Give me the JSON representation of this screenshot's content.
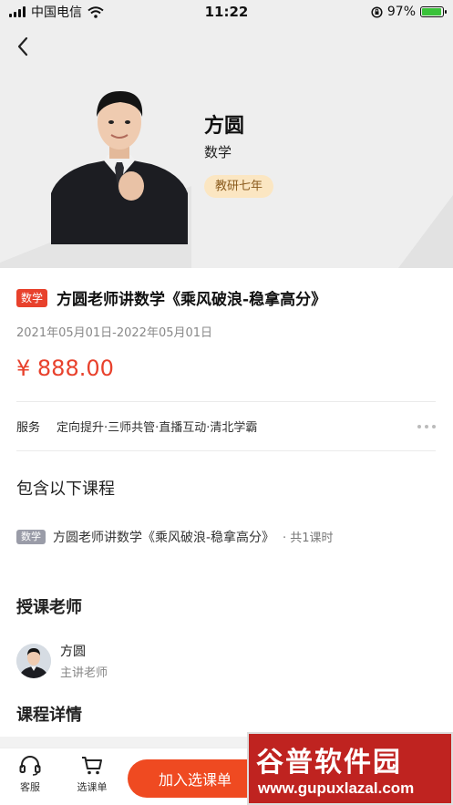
{
  "status_bar": {
    "carrier": "中国电信",
    "time": "11:22",
    "battery": "97%",
    "battery_level": 0.97
  },
  "hero": {
    "name": "方圆",
    "subject": "数学",
    "badge": "教研七年"
  },
  "course": {
    "tag": "数学",
    "title": "方圆老师讲数学《乘风破浪-稳拿高分》",
    "dates": "2021年05月01日-2022年05月01日",
    "price": "¥ 888.00"
  },
  "service": {
    "label": "服务",
    "items": "定向提升·三师共管·直播互动·清北学霸"
  },
  "included": {
    "title": "包含以下课程",
    "item_tag": "数学",
    "item_title": "方圆老师讲数学《乘风破浪-稳拿高分》",
    "item_count": "· 共1课时"
  },
  "teachers": {
    "title": "授课老师",
    "name": "方圆",
    "role": "主讲老师"
  },
  "details": {
    "title": "课程详情"
  },
  "bottom_bar": {
    "service_label": "客服",
    "cart_label": "选课单",
    "cta_label": "加入选课单"
  },
  "watermark": {
    "top": "谷普软件园",
    "bottom": "www.gupuxlazal.com"
  },
  "colors": {
    "accent": "#e8412c",
    "cta": "#ef4a21",
    "badge_bg": "#fbe6c2"
  }
}
